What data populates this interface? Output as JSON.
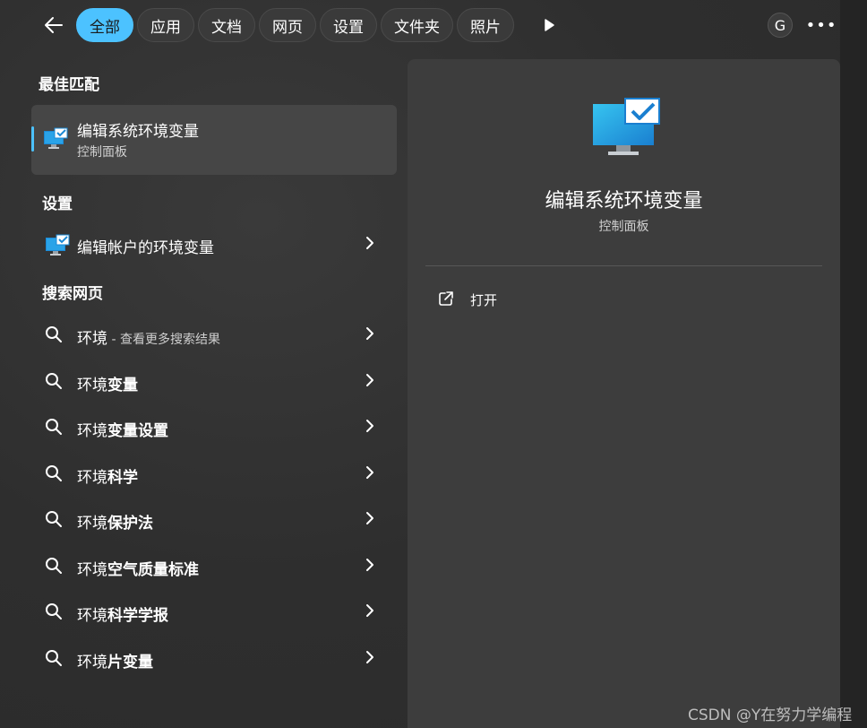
{
  "tabs": [
    {
      "label": "全部",
      "active": true
    },
    {
      "label": "应用"
    },
    {
      "label": "文档"
    },
    {
      "label": "网页"
    },
    {
      "label": "设置"
    },
    {
      "label": "文件夹"
    },
    {
      "label": "照片"
    }
  ],
  "avatar_letter": "G",
  "more_options": "•••",
  "best_match": {
    "section_title": "最佳匹配",
    "title": "编辑系统环境变量",
    "subtitle": "控制面板"
  },
  "settings": {
    "section_title": "设置",
    "items": [
      {
        "label": "编辑帐户的环境变量"
      }
    ]
  },
  "web": {
    "section_title": "搜索网页",
    "first": {
      "prefix": "环境",
      "hint": " - 查看更多搜索结果"
    },
    "items": [
      {
        "prefix": "环境",
        "bold": "变量"
      },
      {
        "prefix": "环境",
        "bold": "变量设置"
      },
      {
        "prefix": "环境",
        "bold": "科学"
      },
      {
        "prefix": "环境",
        "bold": "保护法"
      },
      {
        "prefix": "环境",
        "bold": "空气质量标准"
      },
      {
        "prefix": "环境",
        "bold": "科学学报"
      },
      {
        "prefix": "环境",
        "bold": "片变量"
      }
    ]
  },
  "detail": {
    "title": "编辑系统环境变量",
    "subtitle": "控制面板",
    "action_open": "打开"
  },
  "watermark": "CSDN @Y在努力学编程",
  "colors": {
    "accent": "#4cc2ff",
    "panel": "#3d3d3d"
  }
}
